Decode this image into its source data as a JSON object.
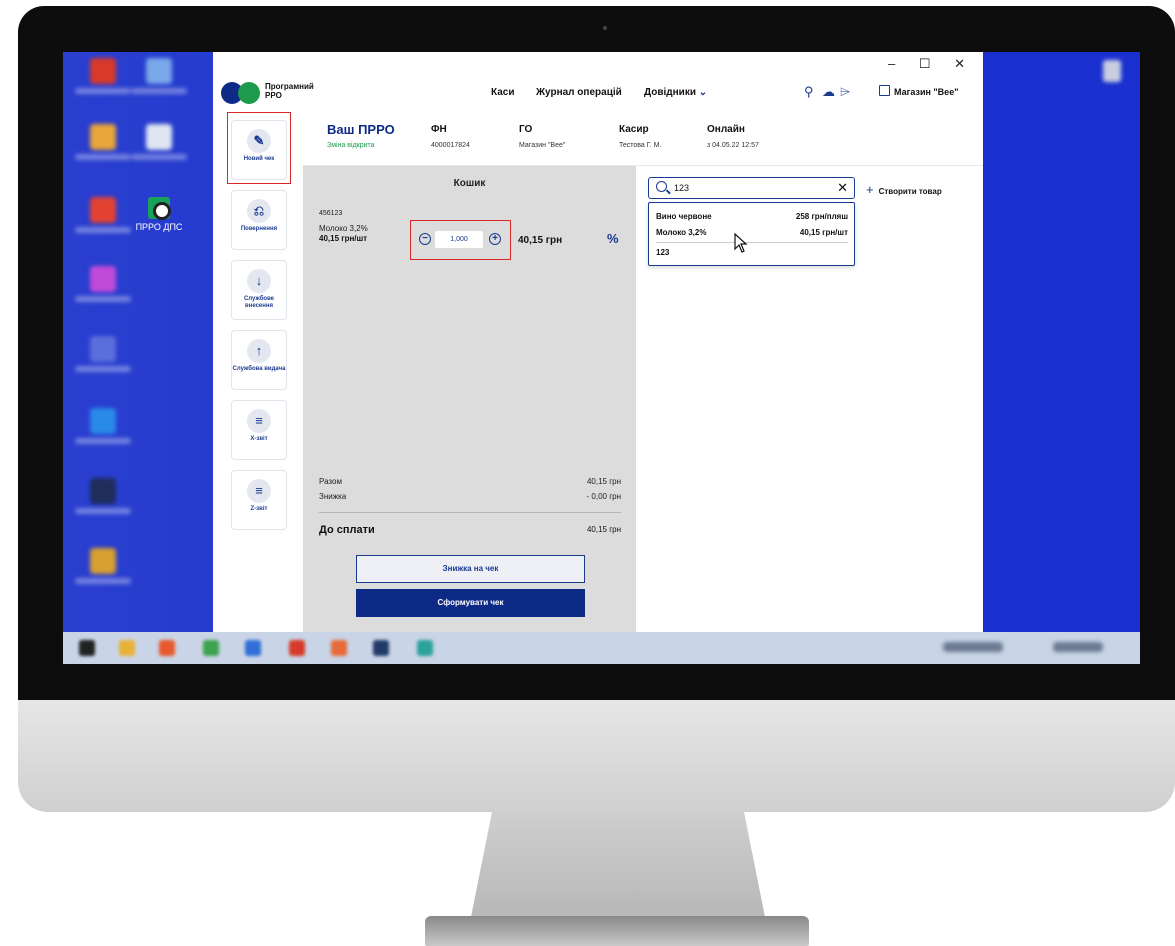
{
  "window": {
    "controls": "– ☐ ✕"
  },
  "desktop": {
    "shortcut_label": "ПРРО ДПС",
    "taskbar_colors": [
      "#222222",
      "#e8b23a",
      "#e65a2e",
      "#3aa34c",
      "#2f6fd6",
      "#d63a2a",
      "#e86a3a",
      "#223a6a",
      "#2aa39a"
    ]
  },
  "header": {
    "logo_line1": "Програмний",
    "logo_line2": "РРО",
    "nav": [
      "Каси",
      "Журнал операцій",
      "Довідники"
    ],
    "nav_dropdown_icon": "chevron-down-icon",
    "tool_icons": [
      "wrench-icon",
      "cloud-upload-icon",
      "tag-icon"
    ],
    "store_name": "Магазин \"Bee\""
  },
  "sidebar": {
    "items": [
      {
        "label": "Новий чек",
        "icon": "edit-icon",
        "glyph": "✎"
      },
      {
        "label": "Повернення",
        "icon": "return-icon",
        "glyph": "⎌"
      },
      {
        "label": "Службове внесення",
        "icon": "arrow-down-icon",
        "glyph": "↓"
      },
      {
        "label": "Службова видача",
        "icon": "arrow-up-icon",
        "glyph": "↑"
      },
      {
        "label": "Х-звіт",
        "icon": "x-report-icon",
        "glyph": "≡"
      },
      {
        "label": "Z-звіт",
        "icon": "z-report-icon",
        "glyph": "≡"
      }
    ]
  },
  "infobar": {
    "ppro_title": "Ваш ПРРО",
    "ppro_status": "Зміна відкрита",
    "fn_title": "ФН",
    "fn_value": "4000017824",
    "go_title": "ГО",
    "go_value": "Магазин \"Bee\"",
    "cashier_title": "Касир",
    "cashier_value": "Тестова Г. М.",
    "online_title": "Онлайн",
    "online_value": "з 04.05.22 12:57"
  },
  "cart": {
    "title": "Кошик",
    "item": {
      "code": "456123",
      "name": "Молоко 3,2%",
      "unit_price": "40,15 грн/шт",
      "quantity": "1,000",
      "total": "40,15 грн"
    },
    "discount_icon": "%",
    "summary": {
      "subtotal_label": "Разом",
      "subtotal_value": "40,15 грн",
      "discount_label": "Знижка",
      "discount_value": "- 0,00 грн",
      "due_label": "До сплати",
      "due_value": "40,15 грн"
    },
    "discount_button": "Знижка на чек",
    "submit_button": "Сформувати чек"
  },
  "search": {
    "value": "123",
    "create_label": "Створити товар",
    "results": [
      {
        "name": "Вино червоне",
        "price": "258 грн/пляш"
      },
      {
        "name": "Молоко 3,2%",
        "price": "40,15 грн/шт"
      },
      {
        "name": "123",
        "price": ""
      }
    ]
  }
}
